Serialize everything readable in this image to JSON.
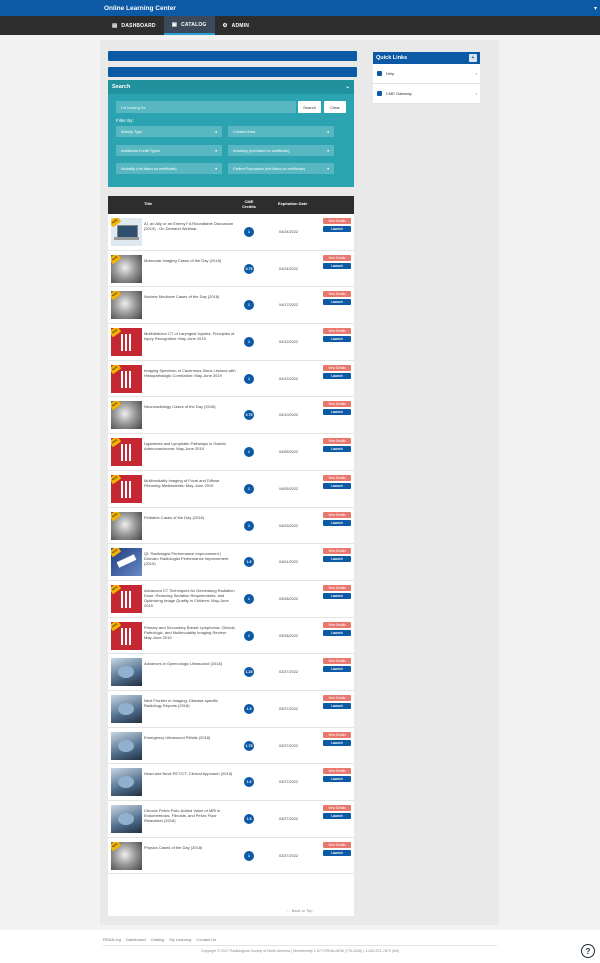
{
  "header": {
    "title": "Online Learning Center",
    "caret": "▾"
  },
  "nav": {
    "tabs": [
      {
        "label": "DASHBOARD",
        "icon": "▤",
        "icon_name": "dashboard-icon"
      },
      {
        "label": "CATALOG",
        "icon": "▣",
        "icon_name": "book-icon"
      },
      {
        "label": "ADMIN",
        "icon": "⚙",
        "icon_name": "gear-icon"
      }
    ]
  },
  "search": {
    "title": "Search",
    "toggle": "⌄",
    "placeholder": "I'm looking for",
    "search_btn": "Search",
    "clear_btn": "Clear",
    "filter_label": "Filter By:",
    "filters": [
      "Activity Type",
      "Content Area",
      "Additional Credit Types",
      "Anatomy (not listed on certificate)",
      "Modality (not listed on certificate)",
      "Patient Population (not listed on certificate)"
    ],
    "dd_caret": "▾"
  },
  "table": {
    "headers": {
      "title": "Title",
      "credits": "CME Credits",
      "expiration": "Expiration Date"
    },
    "view_details": "View Details",
    "launch": "Launch",
    "rows": [
      {
        "title": "AI, an Ally or an Enemy? A Roundtable Discussion (2019) - On Demand Webinar",
        "credit": "1",
        "date": "04/24/2022",
        "img": "laptop",
        "badge": "NEW"
      },
      {
        "title": "Molecular Imaging Cases of the Day (2018)",
        "credit": "0.75",
        "date": "04/24/2022",
        "img": "gray",
        "badge": "NEW"
      },
      {
        "title": "Nuclear Medicine Cases of the Day (2018)",
        "credit": "1",
        "date": "04/17/2022",
        "img": "gray",
        "badge": "NEW"
      },
      {
        "title": "Multidetector CT of Laryngeal Injuries: Principles of Injury Recognition: May-June 2019",
        "credit": "1",
        "date": "04/12/2022",
        "img": "red",
        "badge": "NEW"
      },
      {
        "title": "Imaging Spectrum of Cavernous Sinus Lesions with Histopathologic Correlation: May-June 2019",
        "credit": "1",
        "date": "04/12/2022",
        "img": "red",
        "badge": "NEW"
      },
      {
        "title": "Neuroradiology Cases of the Day (2018)",
        "credit": "0.75",
        "date": "04/10/2022",
        "img": "gray",
        "badge": "NEW"
      },
      {
        "title": "Ligaments and Lymphatic Pathways in Gastric Adenocarcinoma: May-June 2019",
        "credit": "1",
        "date": "04/05/2022",
        "img": "red",
        "badge": "NEW"
      },
      {
        "title": "Multimodality Imaging of Focal and Diffuse Fibrosing Mediastinitis: May-June 2019",
        "credit": "1",
        "date": "04/05/2022",
        "img": "red",
        "badge": "NEW"
      },
      {
        "title": "Pediatric Cases of the Day (2018)",
        "credit": "1",
        "date": "04/03/2022",
        "img": "gray",
        "badge": "NEW"
      },
      {
        "title": "QI: Radiologist Performance Improvement | Domain: Radiologist Performance Improvement (2019)",
        "credit": "1.5",
        "date": "04/01/2022",
        "img": "blue",
        "badge": "NEW"
      },
      {
        "title": "Advanced CT Techniques for Decreasing Radiation Dose, Reducing Sedation Requirements, and Optimizing Image Quality in Children: May-June 2019",
        "credit": "1",
        "date": "03/28/2022",
        "img": "red",
        "badge": "NEW"
      },
      {
        "title": "Primary and Secondary Breast Lymphoma: Clinical, Pathologic, and Multimodality Imaging Review: May-June 2019",
        "credit": "1",
        "date": "03/28/2022",
        "img": "red",
        "badge": "NEW"
      },
      {
        "title": "Advances in Gynecologic Ultrasound (2018)",
        "credit": "1.25",
        "date": "03/27/2022",
        "img": "us",
        "badge": ""
      },
      {
        "title": "Next Frontier in Imaging: Disease-specific Radiology Reports (2018)",
        "credit": "1.5",
        "date": "03/27/2022",
        "img": "us",
        "badge": ""
      },
      {
        "title": "Emergency Ultrasound Pitfalls (2018)",
        "credit": "1.75",
        "date": "03/27/2022",
        "img": "us",
        "badge": ""
      },
      {
        "title": "Head and Neck PET/CT: Clinical Approach (2018)",
        "credit": "1.5",
        "date": "03/27/2022",
        "img": "us",
        "badge": ""
      },
      {
        "title": "Chronic Pelvic Pain: Added Value of MRI in Endometriosis, Fibroids, and Pelvic Floor Relaxation (2018)",
        "credit": "1.5",
        "date": "03/27/2022",
        "img": "us",
        "badge": ""
      },
      {
        "title": "Physics Cases of the Day (2018)",
        "credit": "1",
        "date": "03/27/2022",
        "img": "gray",
        "badge": "NEW"
      }
    ]
  },
  "back_to_top": "← Back to Top",
  "quick_links": {
    "title": "Quick Links",
    "plus": "+",
    "items": [
      {
        "label": "Help",
        "arrow": "›"
      },
      {
        "label": "CME Gateway",
        "arrow": "›"
      }
    ]
  },
  "footer": {
    "links": [
      "RSNA.org",
      "Dashboard",
      "Catalog",
      "My Learning",
      "Contact Us"
    ],
    "copyright": "Copyright © 2017 Radiological Society of North America | Membership 1-877-RSNA-MEM (776-2636) | 1-630-571-7873 (Intl)"
  },
  "help_icon": "?"
}
